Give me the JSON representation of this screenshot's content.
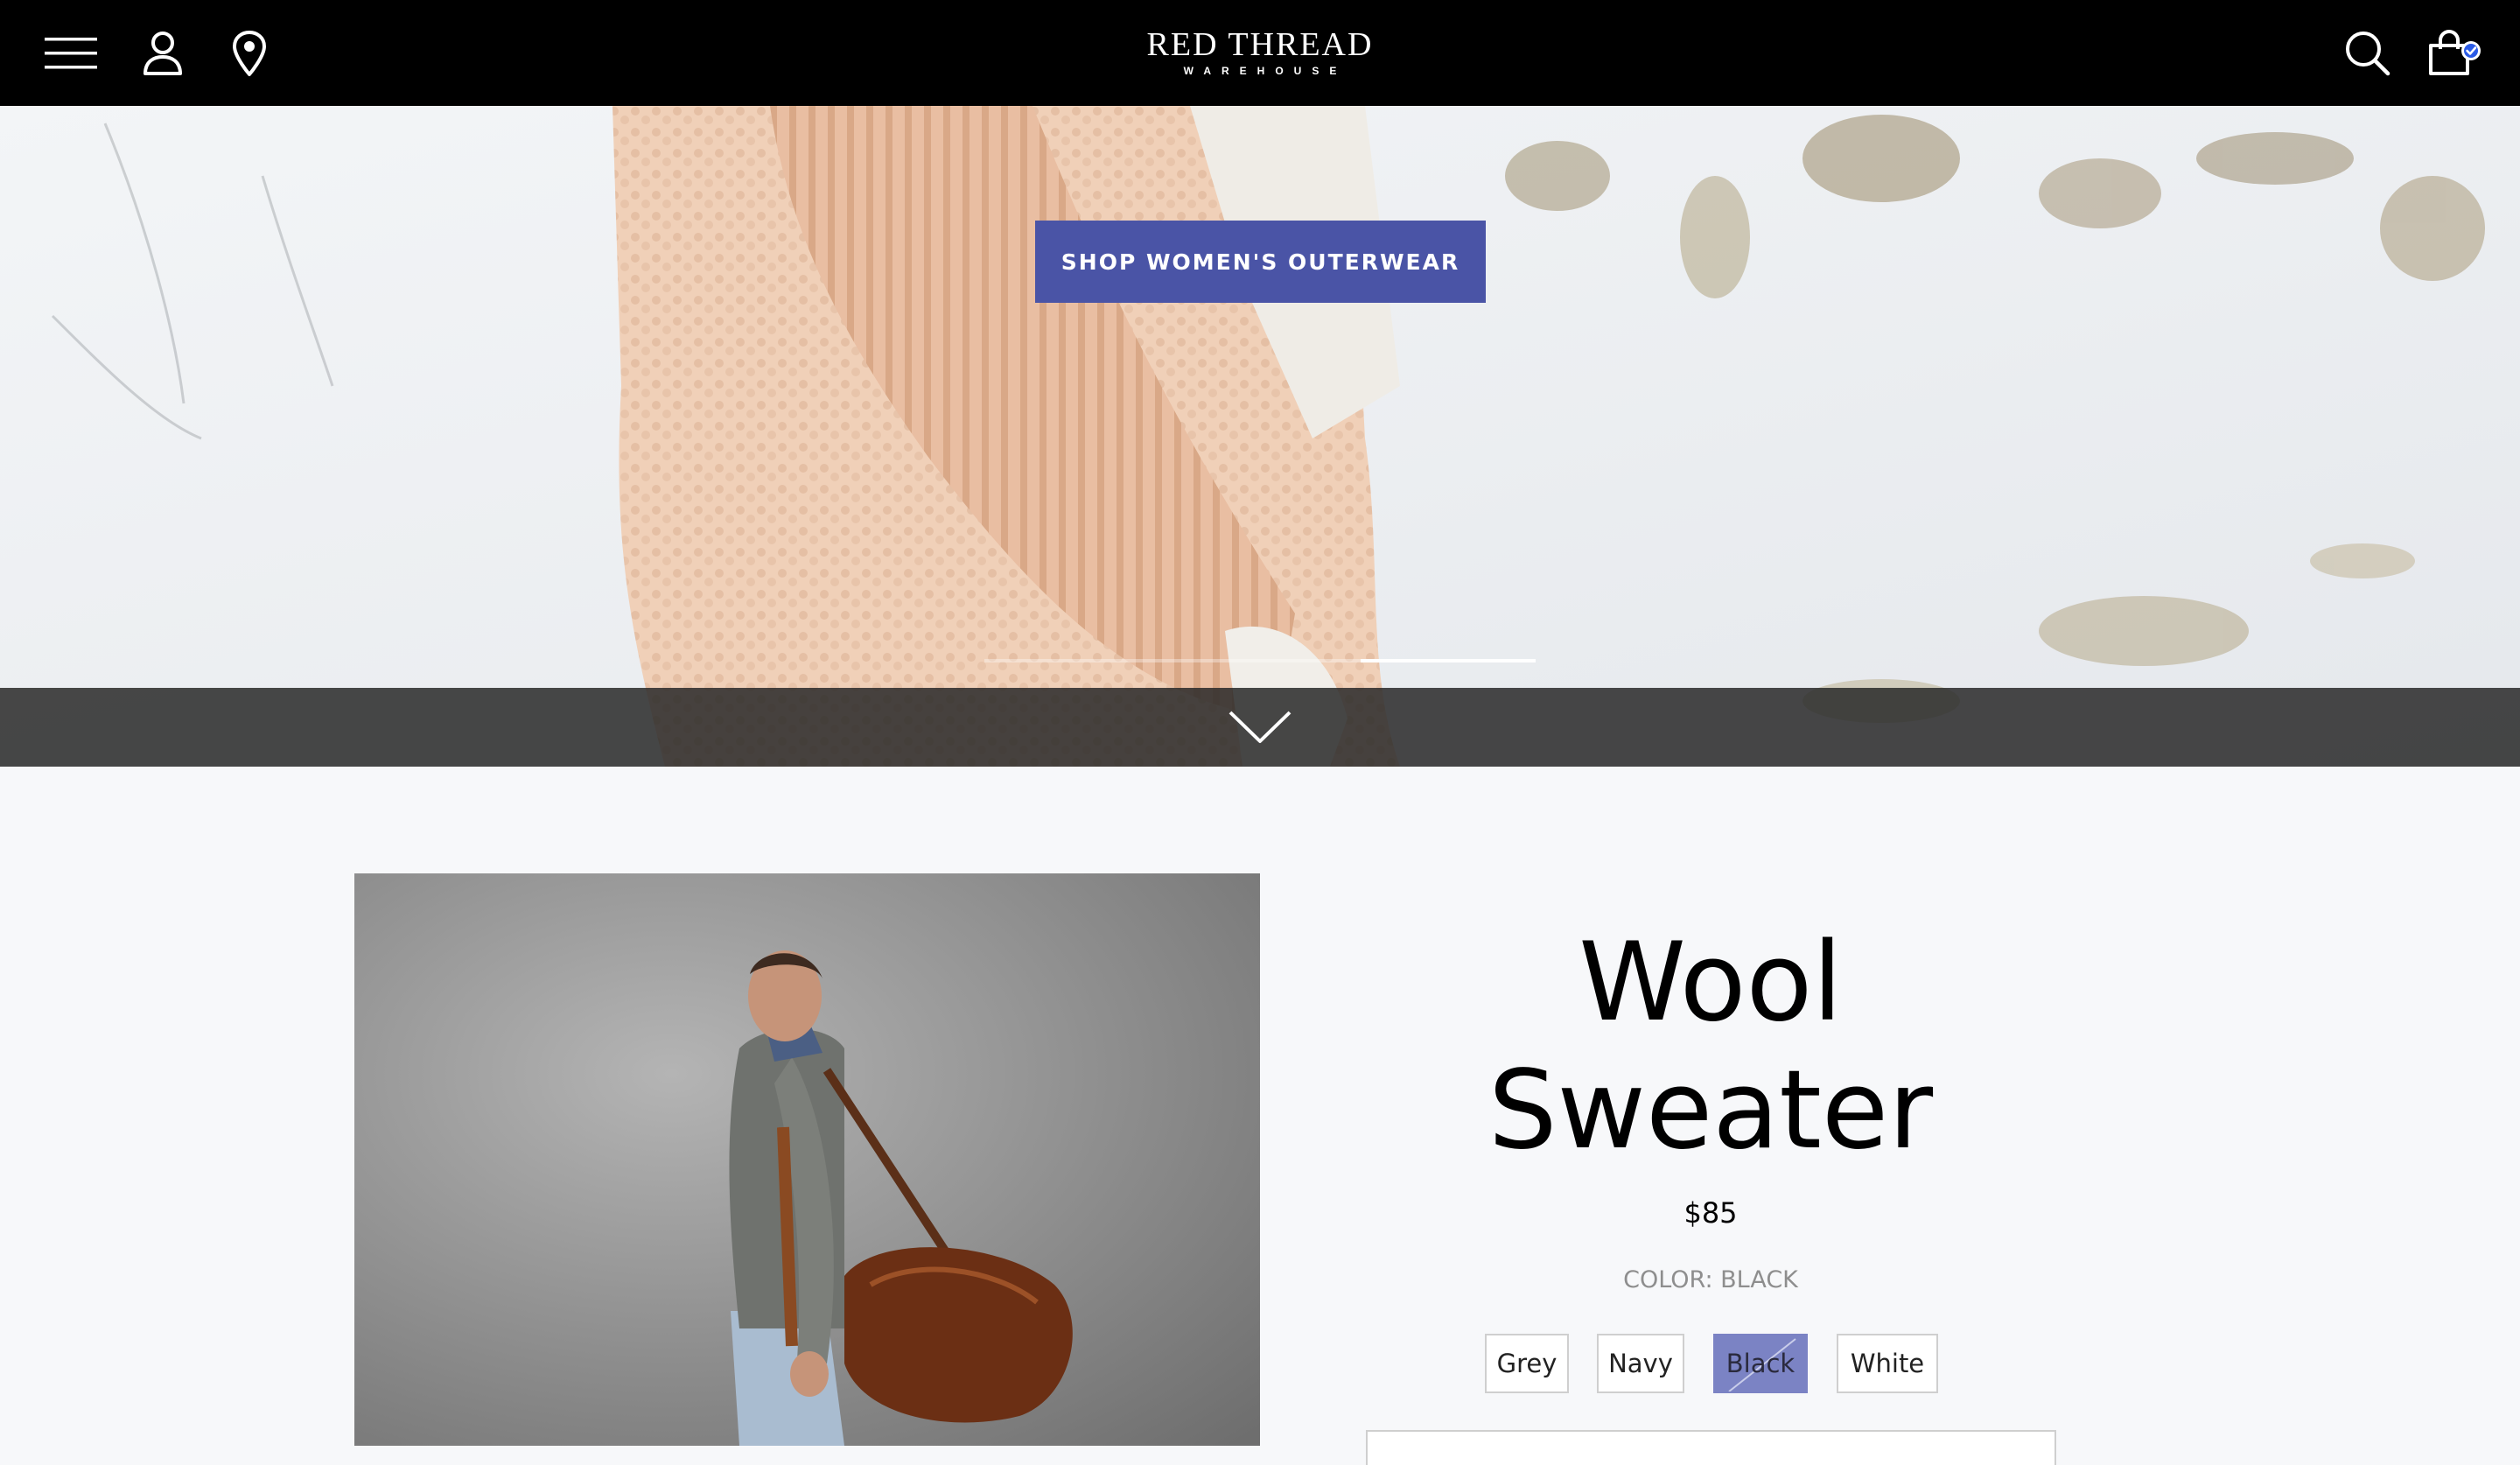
{
  "brand": {
    "name": "RED THREAD",
    "tagline": "WAREHOUSE"
  },
  "nav": {
    "left_icons": [
      "menu-icon",
      "account-icon",
      "location-icon"
    ],
    "right_icons": [
      "search-icon",
      "shopping-bag-icon"
    ]
  },
  "hero": {
    "cta_label": "SHOP WOMEN'S OUTERWEAR",
    "slides_total": 2,
    "active_slide": 2,
    "scroll_icon": "chevron-down-icon"
  },
  "product": {
    "title_line1": "Wool",
    "title_line2": "Sweater",
    "price": "$85",
    "color_label": "COLOR: BLACK",
    "colors": [
      {
        "label": "Grey",
        "selected": false,
        "available": true
      },
      {
        "label": "Navy",
        "selected": false,
        "available": true
      },
      {
        "label": "Black",
        "selected": true,
        "available": false
      },
      {
        "label": "White",
        "selected": false,
        "available": true
      }
    ]
  },
  "colors": {
    "nav_background": "#000000",
    "accent": "#4a54a6",
    "selected_swatch": "#7b83c4",
    "page_background": "#f7f8fa"
  }
}
